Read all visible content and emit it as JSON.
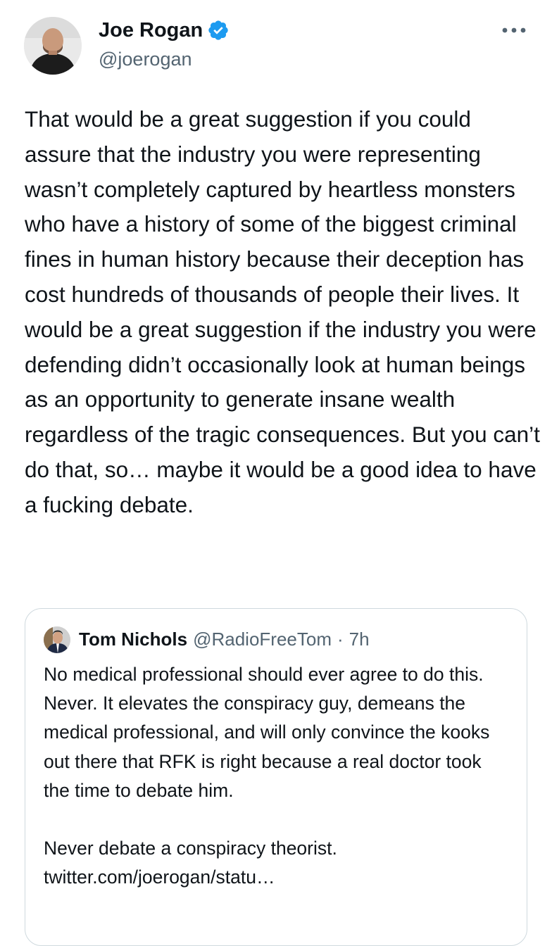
{
  "tweet": {
    "author": {
      "display_name": "Joe Rogan",
      "handle": "@joerogan",
      "verified": true,
      "avatar_icon": "profile-photo"
    },
    "more_icon": "more-horizontal-icon",
    "text": "That would be a great suggestion if you could assure that the industry you were representing wasn’t completely captured by heartless monsters who have a history of some of the biggest criminal fines in human history because their deception has cost hundreds of thousands of people their lives. It would be a great suggestion if the industry you were defending didn’t  occasionally look at human beings as an opportunity to generate insane wealth regardless of the tragic consequences.    But you can’t do that, so… maybe it would be a good idea to have a fucking debate."
  },
  "quoted_tweet": {
    "display_name": "Tom Nichols",
    "handle": "@RadioFreeTom",
    "separator": "·",
    "time": "7h",
    "text": "No medical professional should ever agree to do this. Never. It elevates the conspiracy guy, demeans the medical professional, and will only convince the kooks out there that RFK is right because a real doctor took the time to debate him.\n\nNever debate a conspiracy theorist. twitter.com/joerogan/statu…"
  },
  "colors": {
    "text": "#0f1419",
    "secondary": "#536471",
    "verified_blue": "#1d9bf0",
    "border": "#cfd9de",
    "background": "#ffffff"
  }
}
